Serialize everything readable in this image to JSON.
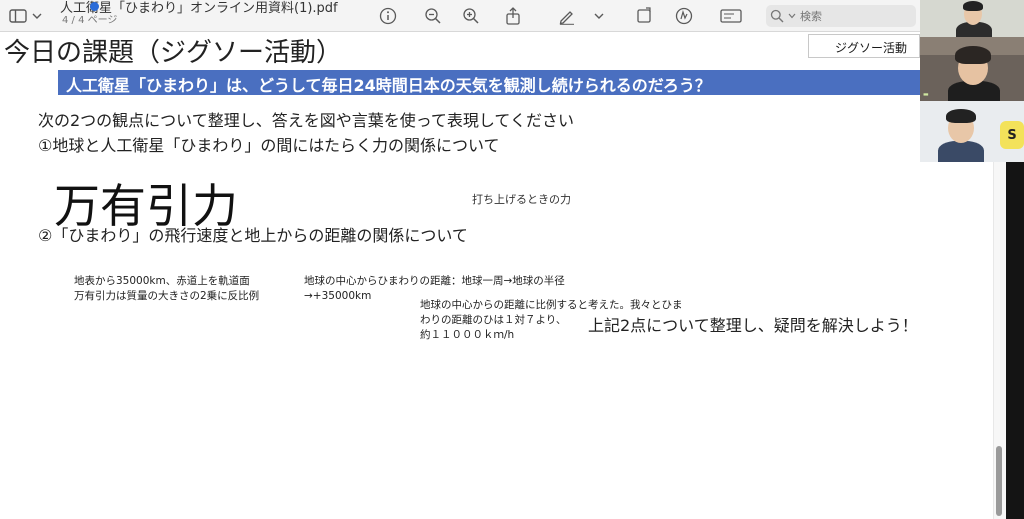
{
  "toolbar": {
    "document_title": "人工衛星「ひまわり」オンライン用資料(1).pdf",
    "page_count": "4 / 4 ページ",
    "search_placeholder": "検索",
    "icons": [
      "sidebar-toggle-icon",
      "chevron-down-icon",
      "info-icon",
      "zoom-out-icon",
      "zoom-in-icon",
      "share-icon",
      "pen-markup-icon",
      "chevron-down-icon",
      "crop-icon",
      "markup-circle-icon",
      "form-icon",
      "search-icon"
    ]
  },
  "document": {
    "heading": "今日の課題（ジグソー活動）",
    "tag_label": "ジグソー活動",
    "banner": "人工衛星「ひまわり」は、どうして毎日24時間日本の天気を観測し続けられるのだろう？",
    "instruction": "次の2つの観点について整理し、答えを図や言葉を使って表現してください",
    "question1": "①地球と人工衛星「ひまわり」の間にはたらく力の関係について",
    "answer1": "万有引力",
    "note_launch": "打ち上げるときの力",
    "question2": "②「ひまわり」の飛行速度と地上からの距離の関係について",
    "note_a": [
      "地表から35000km、赤道上を軌道面",
      "万有引力は質量の大きさの2乗に反比例"
    ],
    "note_b": [
      "地球の中心からひまわりの距離：地球一周→地球の半径",
      "→+35000km"
    ],
    "note_c": [
      "地球の中心からの距離に比例すると考えた。我々とひま",
      "わりの距離のひは１対７より、",
      "約１１０００ｋｍ/h"
    ],
    "closing": "上記2点について整理し、疑問を解決しよう！"
  },
  "colors": {
    "banner_bg": "#4a6fc0",
    "toolbar_bg": "#f4f4f4",
    "accent_blue": "#2a6bd8"
  },
  "participants": {
    "logo_text": "S"
  }
}
